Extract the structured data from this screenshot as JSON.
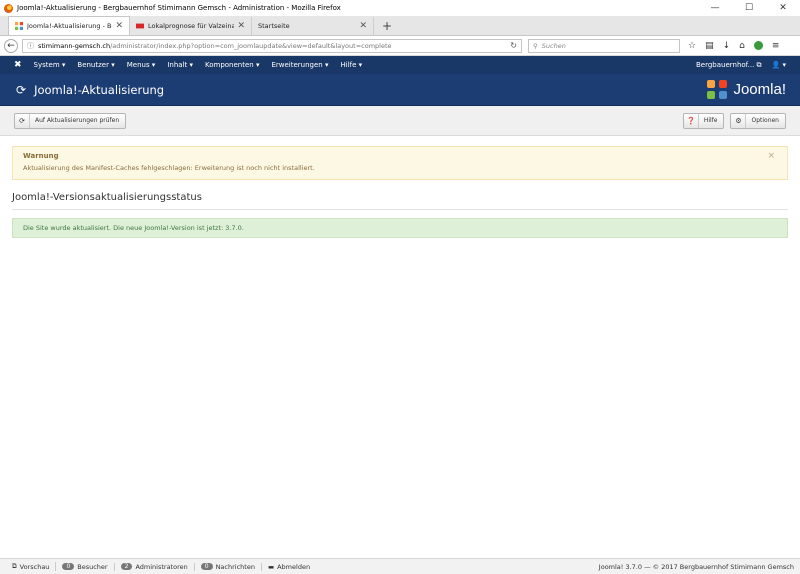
{
  "window": {
    "title": "Joomla!-Aktualisierung - Bergbauernhof Stimimann Gemsch - Administration - Mozilla Firefox",
    "controls": [
      "—",
      "☐",
      "✕"
    ]
  },
  "tabs": [
    {
      "title": "Joomla!-Aktualisierung - Be",
      "active": true
    },
    {
      "title": "Lokalprognose für Valzeina",
      "active": false
    },
    {
      "title": "Startseite",
      "active": false
    }
  ],
  "newtab_label": "+",
  "address": {
    "host": "stimimann-gemsch.ch",
    "path": "/administrator/index.php?option=com_joomlaupdate&view=default&layout=complete"
  },
  "search": {
    "placeholder": "Suchen"
  },
  "menu": {
    "items": [
      "System ▾",
      "Benutzer ▾",
      "Menus ▾",
      "Inhalt ▾",
      "Komponenten ▾",
      "Erweiterungen ▾",
      "Hilfe ▾"
    ],
    "site_link": "Bergbauernhof...",
    "user": "▾"
  },
  "header": {
    "title": "Joomla!-Aktualisierung",
    "brand": "Joomla!"
  },
  "toolbar": {
    "check_updates": "Auf Aktualisierungen prüfen",
    "help": "Hilfe",
    "options": "Optionen"
  },
  "warning": {
    "heading": "Warnung",
    "message": "Aktualisierung des Manifest-Caches fehlgeschlagen: Erweiterung ist noch nicht installiert.",
    "close": "×"
  },
  "status_section": {
    "title": "Joomla!-Versionsaktualisierungsstatus",
    "message": "Die Site wurde aktualisiert. Die neue Joomla!-Version ist jetzt: 3.7.0."
  },
  "statusbar": {
    "preview": "Vorschau",
    "visitors_count": "0",
    "visitors_label": "Besucher",
    "admins_count": "2",
    "admins_label": "Administratoren",
    "messages_count": "0",
    "messages_label": "Nachrichten",
    "logout": "Abmelden",
    "copyright": "Joomla! 3.7.0 — © 2017 Bergbauernhof Stimimann Gemsch"
  },
  "colors": {
    "menu_bg": "#1a3867",
    "header_bg": "#1c3d73",
    "warning_bg": "#fcf8e3",
    "success_bg": "#dff0d8"
  }
}
